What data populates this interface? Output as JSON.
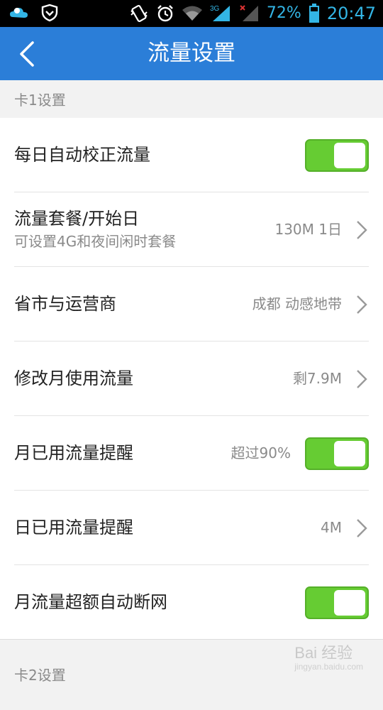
{
  "status_bar": {
    "battery": "72%",
    "time": "20:47",
    "network": "3G",
    "icons": [
      "weather-icon",
      "shield-icon",
      "vibrate-icon",
      "alarm-icon",
      "wifi-icon",
      "signal-3g-icon",
      "signal-no-service-icon",
      "battery-icon"
    ]
  },
  "app_bar": {
    "title": "流量设置",
    "back_icon": "chevron-left-icon"
  },
  "sections": [
    {
      "title": "卡1设置"
    },
    {
      "title": "卡2设置"
    }
  ],
  "rows": [
    {
      "label": "每日自动校正流量",
      "control": "toggle",
      "toggle_on": true
    },
    {
      "label": "流量套餐/开始日",
      "sublabel": "可设置4G和夜间闲时套餐",
      "value": "130M 1日",
      "control": "chevron"
    },
    {
      "label": "省市与运营商",
      "value": "成都 动感地带",
      "control": "chevron"
    },
    {
      "label": "修改月使用流量",
      "value": "剩7.9M",
      "control": "chevron"
    },
    {
      "label": "月已用流量提醒",
      "value": "超过90%",
      "control": "toggle",
      "toggle_on": true
    },
    {
      "label": "日已用流量提醒",
      "value": "4M",
      "control": "chevron"
    },
    {
      "label": "月流量超额自动断网",
      "control": "toggle",
      "toggle_on": true
    }
  ],
  "watermark": {
    "text": "Bai 经验",
    "sub": "jingyan.baidu.com"
  },
  "colors": {
    "app_bar": "#2b7ed8",
    "toggle_on": "#66cc33",
    "status_accent": "#33b5e5"
  }
}
